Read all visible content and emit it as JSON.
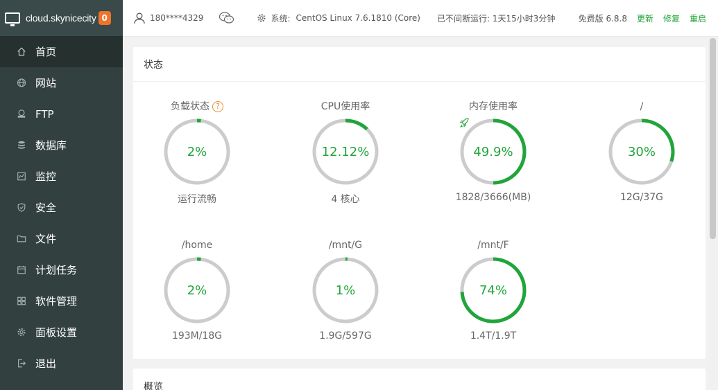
{
  "brand": {
    "name": "cloud.skynicecity",
    "badge": "0"
  },
  "sidebar": {
    "items": [
      {
        "label": "首页",
        "icon": "home-icon",
        "active": true
      },
      {
        "label": "网站",
        "icon": "globe-icon"
      },
      {
        "label": "FTP",
        "icon": "ftp-icon"
      },
      {
        "label": "数据库",
        "icon": "database-icon"
      },
      {
        "label": "监控",
        "icon": "monitor-icon"
      },
      {
        "label": "安全",
        "icon": "shield-icon"
      },
      {
        "label": "文件",
        "icon": "folder-icon"
      },
      {
        "label": "计划任务",
        "icon": "calendar-icon"
      },
      {
        "label": "软件管理",
        "icon": "grid-icon"
      },
      {
        "label": "面板设置",
        "icon": "gear-icon"
      },
      {
        "label": "退出",
        "icon": "logout-icon"
      }
    ]
  },
  "topbar": {
    "user": "180****4329",
    "system_label": "系统:",
    "system_value": "CentOS Linux 7.6.1810 (Core)",
    "runtime": "已不间断运行: 1天15小时3分钟",
    "version": "免费版 6.8.8",
    "update": "更新",
    "repair": "修复",
    "restart": "重启"
  },
  "status": {
    "title": "状态",
    "gauges": [
      {
        "label": "负载状态",
        "help": "?",
        "value": "2%",
        "percent": 2,
        "sub": "运行流畅"
      },
      {
        "label": "CPU使用率",
        "value": "12.12%",
        "percent": 12.12,
        "sub": "4 核心"
      },
      {
        "label": "内存使用率",
        "value": "49.9%",
        "percent": 49.9,
        "sub": "1828/3666(MB)",
        "icon": "rocket-icon"
      },
      {
        "label": "/",
        "value": "30%",
        "percent": 30,
        "sub": "12G/37G"
      },
      {
        "label": "/home",
        "value": "2%",
        "percent": 2,
        "sub": "193M/18G"
      },
      {
        "label": "/mnt/G",
        "value": "1%",
        "percent": 1,
        "sub": "1.9G/597G"
      },
      {
        "label": "/mnt/F",
        "value": "74%",
        "percent": 74,
        "sub": "1.4T/1.9T"
      }
    ]
  },
  "overview": {
    "title": "概览"
  },
  "colors": {
    "accent": "#20a53a",
    "track": "#cccccc",
    "sidebar": "#334040",
    "sidebar_active": "#25302f",
    "badge": "#f0732c"
  }
}
